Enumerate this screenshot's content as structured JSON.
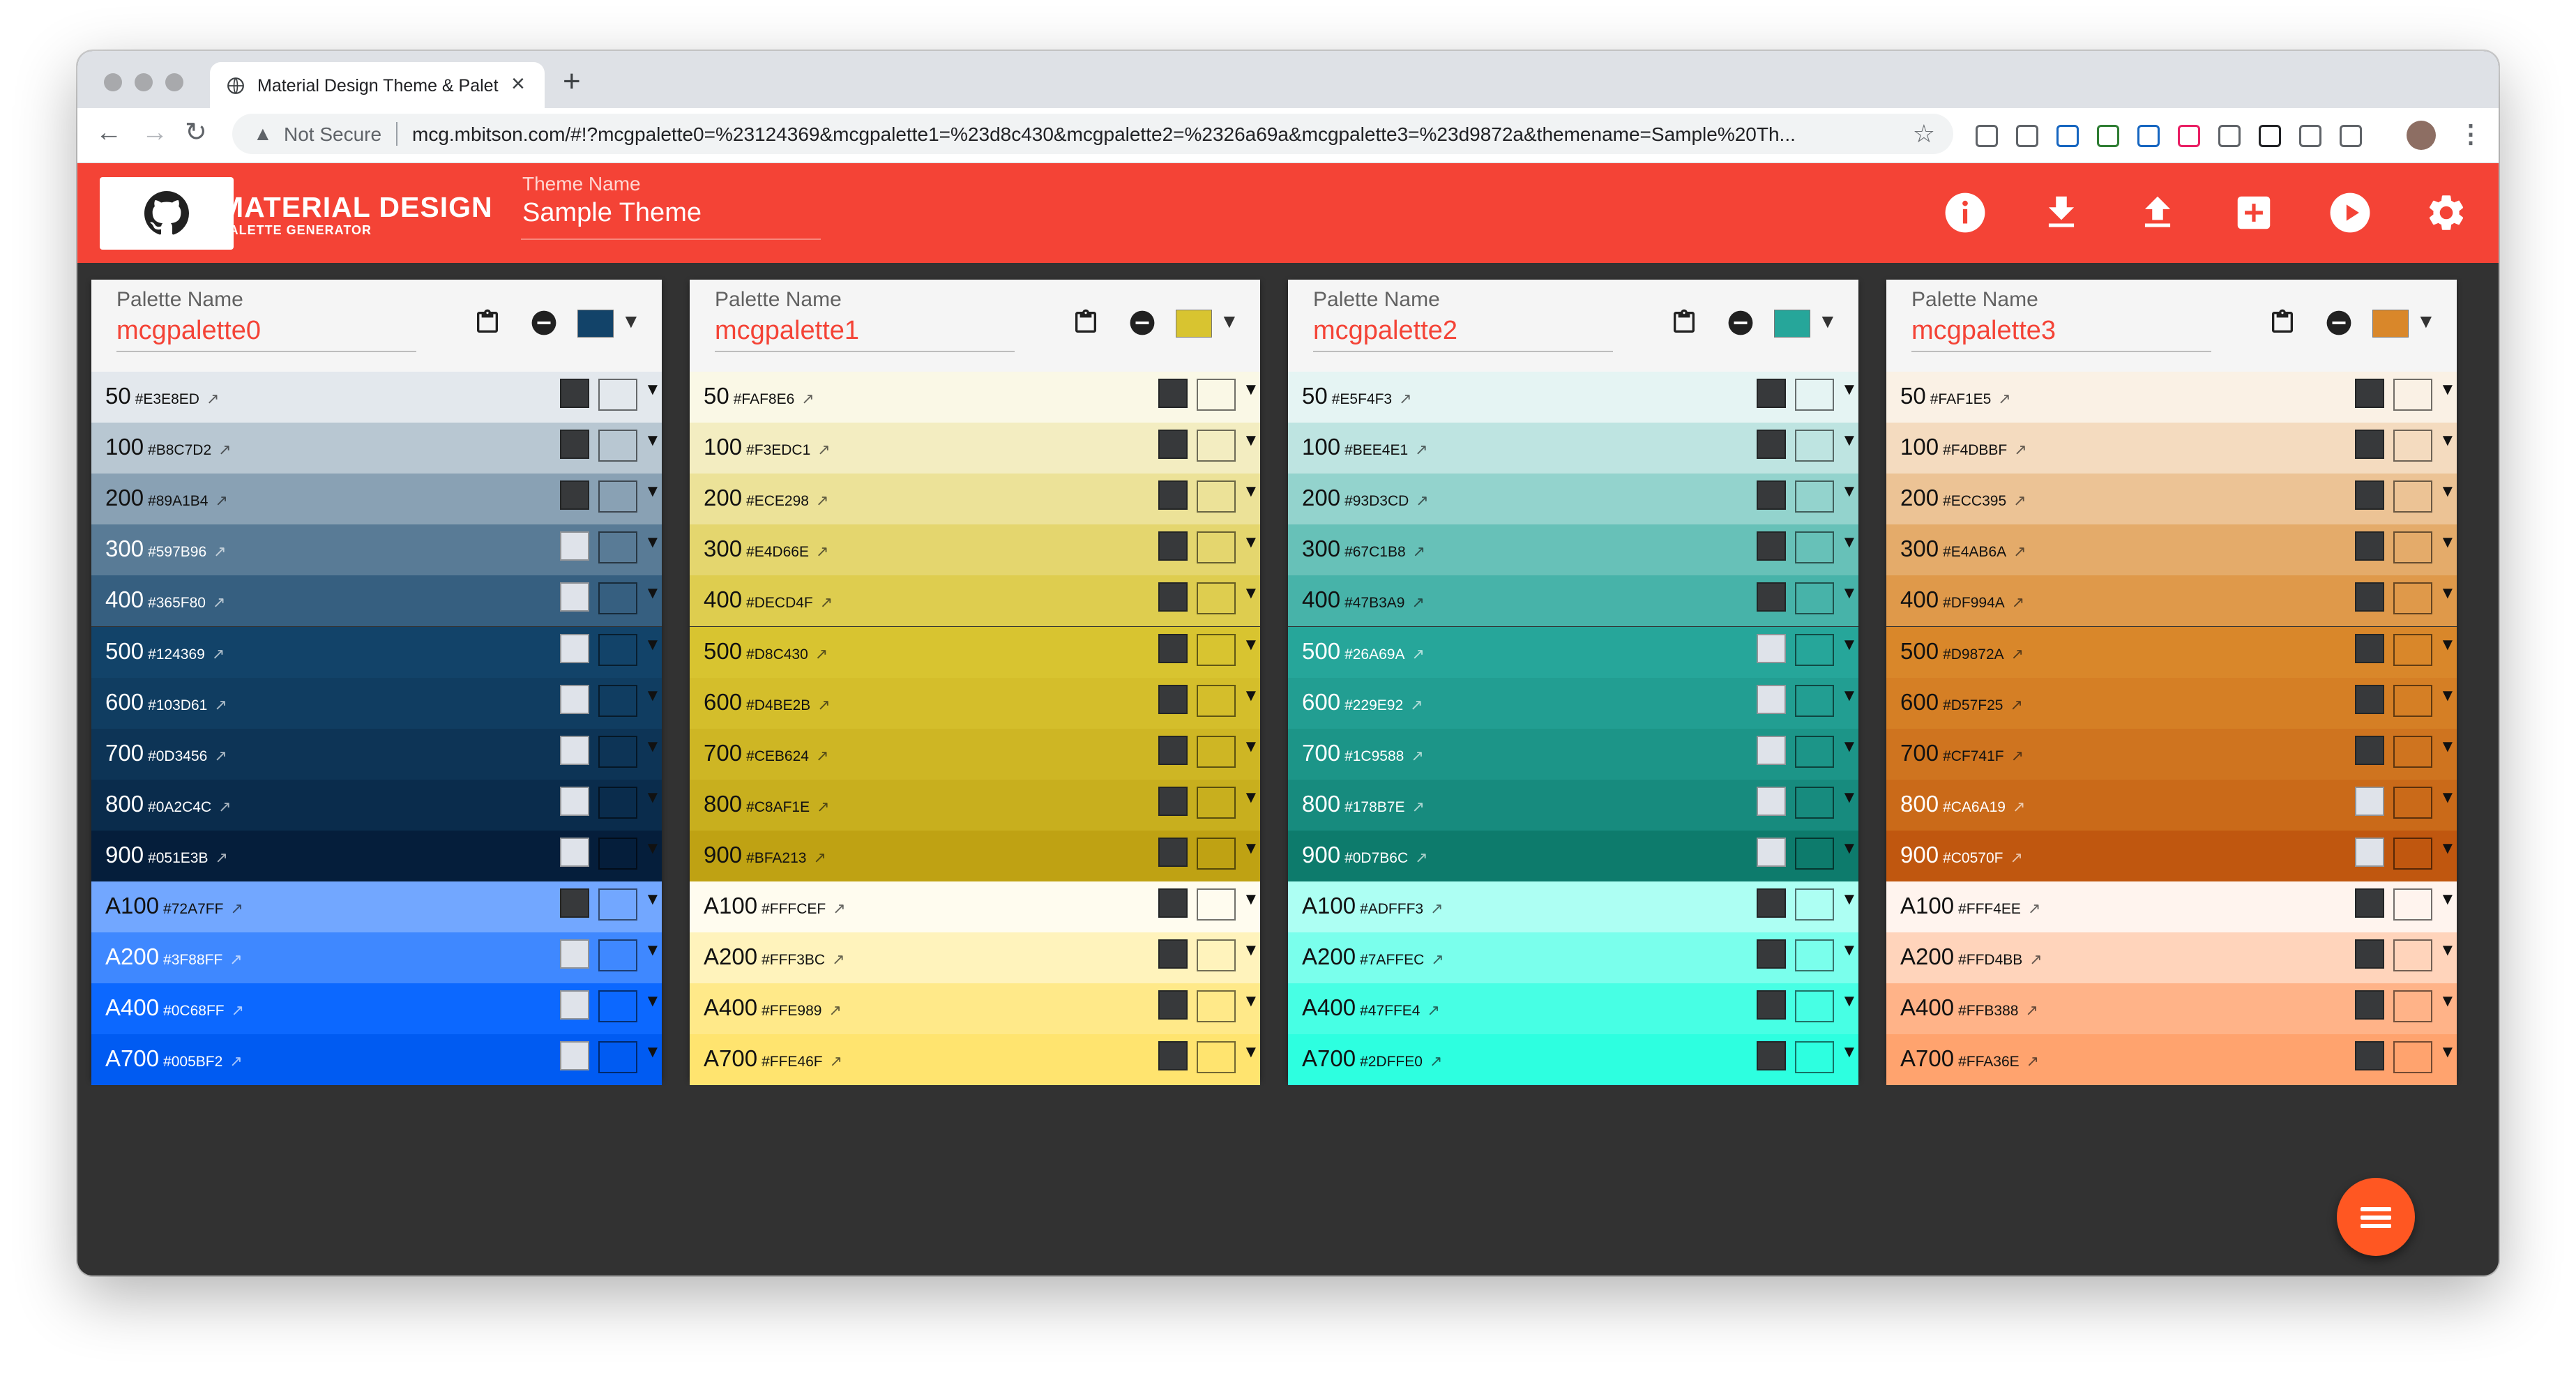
{
  "browser": {
    "tab_title": "Material Design Theme & Palet",
    "not_secure": "Not Secure",
    "url": "mcg.mbitson.com/#!?mcgpalette0=%23124369&mcgpalette1=%23d8c430&mcgpalette2=%2326a69a&mcgpalette3=%23d9872a&themename=Sample%20Th...",
    "extensions": [
      {
        "name": "camera-extension-icon",
        "color": "#5f6368"
      },
      {
        "name": "calendar-extension-icon",
        "color": "#5f6368"
      },
      {
        "name": "trello-extension-icon",
        "color": "#1565c0"
      },
      {
        "name": "s-extension-icon",
        "color": "#2e7d32"
      },
      {
        "name": "news-extension-icon",
        "color": "#1565c0"
      },
      {
        "name": "red-target-extension-icon",
        "color": "#e91e63"
      },
      {
        "name": "image-extension-icon",
        "color": "#5f6368"
      },
      {
        "name": "notion-extension-icon",
        "color": "#202124"
      },
      {
        "name": "puzzle-extension-icon",
        "color": "#5f6368"
      },
      {
        "name": "playlist-extension-icon",
        "color": "#5f6368"
      }
    ]
  },
  "app": {
    "brand_title": "MATERIAL DESIGN",
    "brand_subtitle": "PALETTE GENERATOR",
    "theme_label": "Theme Name",
    "theme_name": "Sample Theme",
    "accent": "#f44336",
    "actions": [
      "info-icon",
      "download-icon",
      "upload-icon",
      "add-box-icon",
      "play-icon",
      "settings-icon"
    ]
  },
  "palette_label": "Palette Name",
  "shade_names": [
    "50",
    "100",
    "200",
    "300",
    "400",
    "500",
    "600",
    "700",
    "800",
    "900",
    "A100",
    "A200",
    "A400",
    "A700"
  ],
  "palettes": [
    {
      "name": "mcgpalette0",
      "base": "#124369",
      "hex": [
        "#E3E8ED",
        "#B8C7D2",
        "#89A1B4",
        "#597B96",
        "#365F80",
        "#124369",
        "#103D61",
        "#0D3456",
        "#0A2C4C",
        "#051E3B",
        "#72A7FF",
        "#3F88FF",
        "#0C68FF",
        "#005BF2"
      ],
      "dark": [
        false,
        false,
        false,
        true,
        true,
        true,
        true,
        true,
        true,
        true,
        false,
        true,
        true,
        true
      ]
    },
    {
      "name": "mcgpalette1",
      "base": "#d8c430",
      "hex": [
        "#FAF8E6",
        "#F3EDC1",
        "#ECE298",
        "#E4D66E",
        "#DECD4F",
        "#D8C430",
        "#D4BE2B",
        "#CEB624",
        "#C8AF1E",
        "#BFA213",
        "#FFFCEF",
        "#FFF3BC",
        "#FFE989",
        "#FFE46F"
      ],
      "dark": [
        false,
        false,
        false,
        false,
        false,
        false,
        false,
        false,
        false,
        false,
        false,
        false,
        false,
        false
      ]
    },
    {
      "name": "mcgpalette2",
      "base": "#26a69a",
      "hex": [
        "#E5F4F3",
        "#BEE4E1",
        "#93D3CD",
        "#67C1B8",
        "#47B3A9",
        "#26A69A",
        "#229E92",
        "#1C9588",
        "#178B7E",
        "#0D7B6C",
        "#ADFFF3",
        "#7AFFEC",
        "#47FFE4",
        "#2DFFE0"
      ],
      "dark": [
        false,
        false,
        false,
        false,
        false,
        true,
        true,
        true,
        true,
        true,
        false,
        false,
        false,
        false
      ]
    },
    {
      "name": "mcgpalette3",
      "base": "#d9872a",
      "hex": [
        "#FAF1E5",
        "#F4DBBF",
        "#ECC395",
        "#E4AB6A",
        "#DF994A",
        "#D9872A",
        "#D57F25",
        "#CF741F",
        "#CA6A19",
        "#C0570F",
        "#FFF4EE",
        "#FFD4BB",
        "#FFB388",
        "#FFA36E"
      ],
      "dark": [
        false,
        false,
        false,
        false,
        false,
        false,
        false,
        false,
        true,
        true,
        false,
        false,
        false,
        false
      ]
    }
  ]
}
